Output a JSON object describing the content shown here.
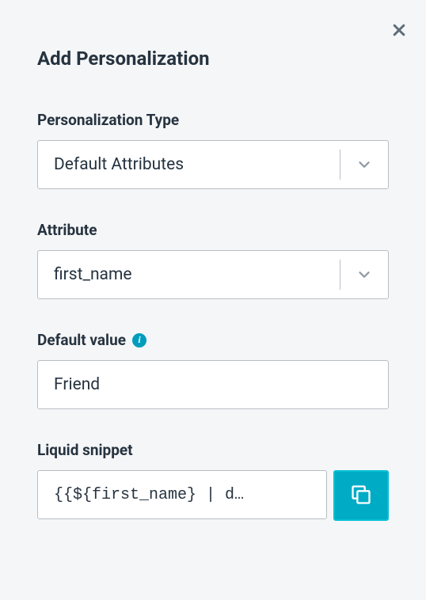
{
  "title": "Add Personalization",
  "fields": {
    "type": {
      "label": "Personalization Type",
      "value": "Default Attributes"
    },
    "attribute": {
      "label": "Attribute",
      "value": "first_name"
    },
    "default_value": {
      "label": "Default value",
      "value": "Friend"
    },
    "snippet": {
      "label": "Liquid snippet",
      "value": "{{${first_name} | default: \"Friend\"}}",
      "display": "{{${first_name} | d…"
    }
  },
  "colors": {
    "accent": "#00abc6",
    "accent_border": "#00c0d4",
    "text_primary": "#263340",
    "border": "#b8bec4"
  }
}
